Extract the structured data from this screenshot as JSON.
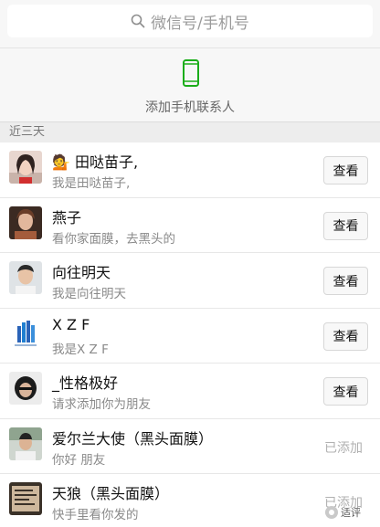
{
  "search": {
    "placeholder": "微信号/手机号",
    "icon": "search-icon"
  },
  "add_contacts": {
    "label": "添加手机联系人",
    "icon": "phone-icon",
    "icon_color": "#1aad19"
  },
  "section": {
    "title": "近三天"
  },
  "requests": [
    {
      "name": "田哒苗子,",
      "message": "我是田哒苗子,",
      "action": "查看",
      "name_has_emoji": true
    },
    {
      "name": "燕子",
      "message": "看你家面膜，去黑头的",
      "action": "查看"
    },
    {
      "name": "向往明天",
      "message": "我是向往明天",
      "action": "查看"
    },
    {
      "name": "X Z F",
      "message": "我是X Z F",
      "action": "查看"
    },
    {
      "name": "_性格极好",
      "message": "请求添加你为朋友",
      "action": "查看"
    },
    {
      "name": "爱尔兰大使（黑头面膜）",
      "message": "你好 朋友",
      "action": "已添加"
    },
    {
      "name": "天狼（黑头面膜）",
      "message": "快手里看你发的",
      "action": "已添加"
    }
  ],
  "watermark": {
    "text": "适评"
  }
}
